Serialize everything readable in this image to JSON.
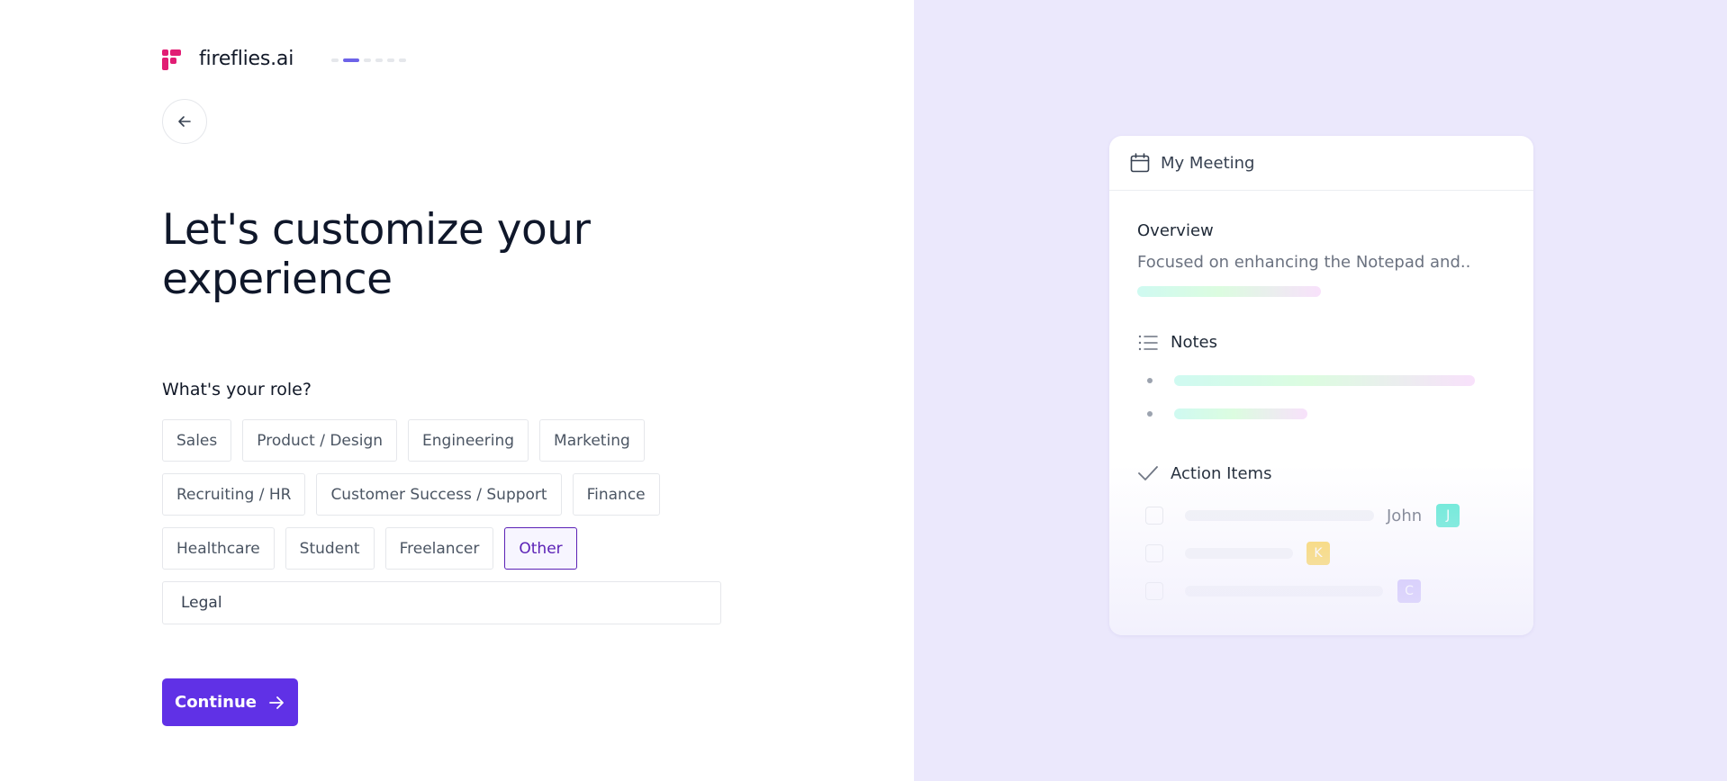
{
  "brand": {
    "name": "fireflies.ai",
    "logo_color": "#e11d74"
  },
  "progress": {
    "steps": 6,
    "current": 2
  },
  "back_button": {
    "icon": "arrow-left-icon"
  },
  "headline": "Let's customize your experience",
  "role_question": "What's your role?",
  "roles": [
    [
      {
        "label": "Sales",
        "selected": false
      },
      {
        "label": "Product / Design",
        "selected": false
      },
      {
        "label": "Engineering",
        "selected": false
      },
      {
        "label": "Marketing",
        "selected": false
      }
    ],
    [
      {
        "label": "Recruiting / HR",
        "selected": false
      },
      {
        "label": "Customer Success / Support",
        "selected": false
      },
      {
        "label": "Finance",
        "selected": false
      }
    ],
    [
      {
        "label": "Healthcare",
        "selected": false
      },
      {
        "label": "Student",
        "selected": false
      },
      {
        "label": "Freelancer",
        "selected": false
      },
      {
        "label": "Other",
        "selected": true
      }
    ]
  ],
  "other_input": {
    "value": "Legal"
  },
  "continue_button": {
    "label": "Continue",
    "color": "#6031e6"
  },
  "preview": {
    "background": "#ebe8fc",
    "card_title": "My Meeting",
    "overview_label": "Overview",
    "overview_text": "Focused on enhancing the Notepad and..",
    "notes_label": "Notes",
    "action_items_label": "Action Items",
    "action_items": [
      {
        "assignee_name": "John",
        "initial": "J",
        "color": "#5eead4"
      },
      {
        "assignee_name": "",
        "initial": "K",
        "color": "#fcd34d"
      },
      {
        "assignee_name": "",
        "initial": "C",
        "color": "#c4b5fd"
      }
    ]
  }
}
